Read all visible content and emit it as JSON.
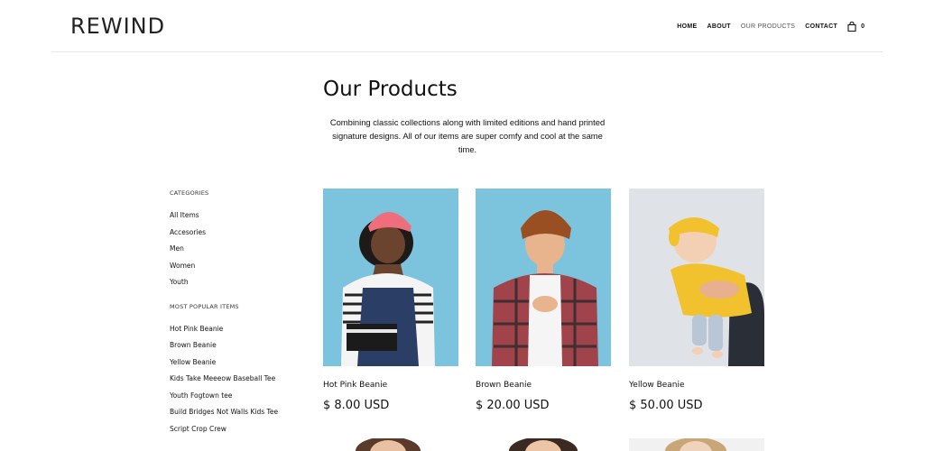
{
  "header": {
    "logo": "REWIND",
    "nav": [
      "HOME",
      "ABOUT",
      "OUR PRODUCTS",
      "CONTACT"
    ],
    "active_nav": "OUR PRODUCTS",
    "cart_count": "0"
  },
  "main": {
    "title": "Our Products",
    "intro": "Combining classic collections along with limited editions and hand printed signature designs. All of our items are super comfy and cool at the same time."
  },
  "sidebar": {
    "categories_heading": "CATEGORIES",
    "categories": [
      "All Items",
      "Accesories",
      "Men",
      "Women",
      "Youth"
    ],
    "popular_heading": "MOST POPULAR ITEMS",
    "popular": [
      "Hot Pink Beanie",
      "Brown Beanie",
      "Yellow Beanie",
      "Kids Take Meeeow Baseball Tee",
      "Youth Fogtown tee",
      "Build Bridges Not Walls Kids Tee",
      "Script Crop Crew"
    ]
  },
  "products": [
    {
      "name": "Hot Pink Beanie",
      "price": "$ 8.00 USD"
    },
    {
      "name": "Brown Beanie",
      "price": "$ 20.00 USD"
    },
    {
      "name": "Yellow Beanie",
      "price": "$ 50.00 USD"
    }
  ],
  "colors": {
    "accent_blue": "#7cc3de",
    "background_grey": "#dfe2e6",
    "beanie_pink": "#ee6e7b",
    "beanie_brown": "#9a4f22",
    "beanie_yellow": "#f2c12e"
  }
}
